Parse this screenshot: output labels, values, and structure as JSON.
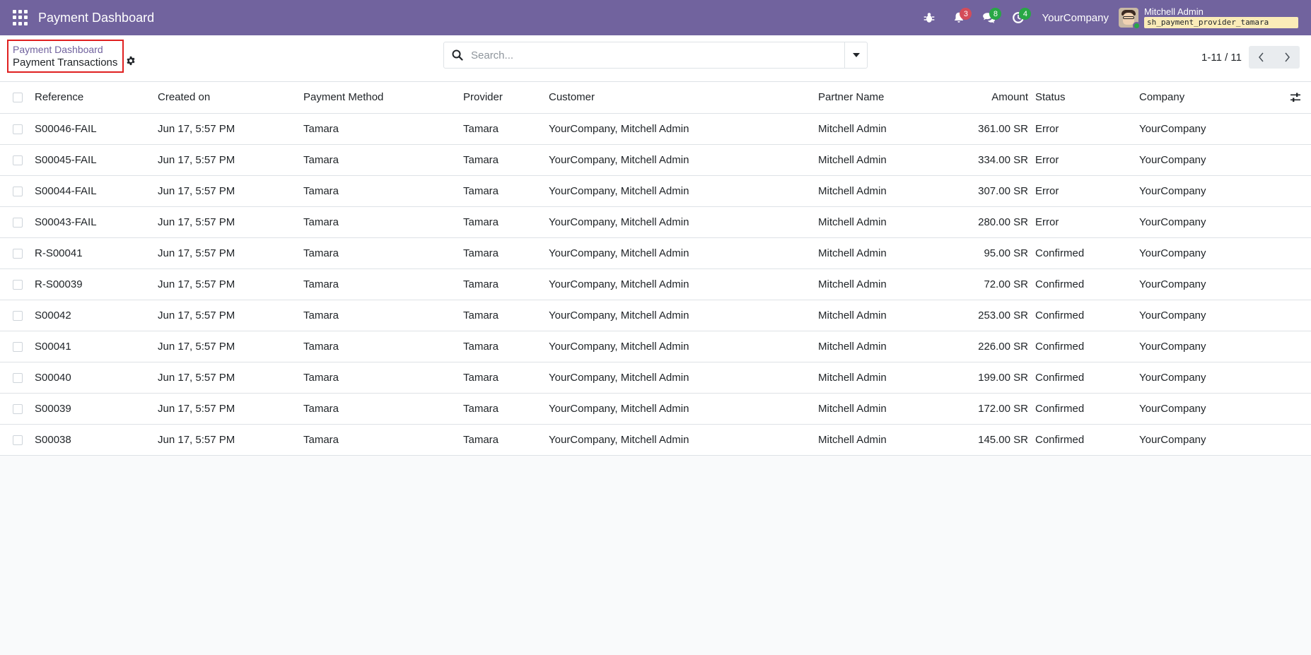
{
  "navbar": {
    "title": "Payment Dashboard",
    "activity_count": "3",
    "messages_count": "8",
    "activities_done_count": "4",
    "company": "YourCompany",
    "user_name": "Mitchell Admin",
    "database": "sh_payment_provider_tamara"
  },
  "breadcrumb": {
    "parent": "Payment Dashboard",
    "current": "Payment Transactions"
  },
  "search": {
    "placeholder": "Search..."
  },
  "pager": {
    "value": "1-11 / 11"
  },
  "table": {
    "headers": {
      "reference": "Reference",
      "created_on": "Created on",
      "payment_method": "Payment Method",
      "provider": "Provider",
      "customer": "Customer",
      "partner_name": "Partner Name",
      "amount": "Amount",
      "status": "Status",
      "company": "Company"
    },
    "rows": [
      {
        "reference": "S00046-FAIL",
        "created_on": "Jun 17, 5:57 PM",
        "payment_method": "Tamara",
        "provider": "Tamara",
        "customer": "YourCompany, Mitchell Admin",
        "partner_name": "Mitchell Admin",
        "amount": "361.00 SR",
        "status": "Error",
        "company": "YourCompany"
      },
      {
        "reference": "S00045-FAIL",
        "created_on": "Jun 17, 5:57 PM",
        "payment_method": "Tamara",
        "provider": "Tamara",
        "customer": "YourCompany, Mitchell Admin",
        "partner_name": "Mitchell Admin",
        "amount": "334.00 SR",
        "status": "Error",
        "company": "YourCompany"
      },
      {
        "reference": "S00044-FAIL",
        "created_on": "Jun 17, 5:57 PM",
        "payment_method": "Tamara",
        "provider": "Tamara",
        "customer": "YourCompany, Mitchell Admin",
        "partner_name": "Mitchell Admin",
        "amount": "307.00 SR",
        "status": "Error",
        "company": "YourCompany"
      },
      {
        "reference": "S00043-FAIL",
        "created_on": "Jun 17, 5:57 PM",
        "payment_method": "Tamara",
        "provider": "Tamara",
        "customer": "YourCompany, Mitchell Admin",
        "partner_name": "Mitchell Admin",
        "amount": "280.00 SR",
        "status": "Error",
        "company": "YourCompany"
      },
      {
        "reference": "R-S00041",
        "created_on": "Jun 17, 5:57 PM",
        "payment_method": "Tamara",
        "provider": "Tamara",
        "customer": "YourCompany, Mitchell Admin",
        "partner_name": "Mitchell Admin",
        "amount": "95.00 SR",
        "status": "Confirmed",
        "company": "YourCompany"
      },
      {
        "reference": "R-S00039",
        "created_on": "Jun 17, 5:57 PM",
        "payment_method": "Tamara",
        "provider": "Tamara",
        "customer": "YourCompany, Mitchell Admin",
        "partner_name": "Mitchell Admin",
        "amount": "72.00 SR",
        "status": "Confirmed",
        "company": "YourCompany"
      },
      {
        "reference": "S00042",
        "created_on": "Jun 17, 5:57 PM",
        "payment_method": "Tamara",
        "provider": "Tamara",
        "customer": "YourCompany, Mitchell Admin",
        "partner_name": "Mitchell Admin",
        "amount": "253.00 SR",
        "status": "Confirmed",
        "company": "YourCompany"
      },
      {
        "reference": "S00041",
        "created_on": "Jun 17, 5:57 PM",
        "payment_method": "Tamara",
        "provider": "Tamara",
        "customer": "YourCompany, Mitchell Admin",
        "partner_name": "Mitchell Admin",
        "amount": "226.00 SR",
        "status": "Confirmed",
        "company": "YourCompany"
      },
      {
        "reference": "S00040",
        "created_on": "Jun 17, 5:57 PM",
        "payment_method": "Tamara",
        "provider": "Tamara",
        "customer": "YourCompany, Mitchell Admin",
        "partner_name": "Mitchell Admin",
        "amount": "199.00 SR",
        "status": "Confirmed",
        "company": "YourCompany"
      },
      {
        "reference": "S00039",
        "created_on": "Jun 17, 5:57 PM",
        "payment_method": "Tamara",
        "provider": "Tamara",
        "customer": "YourCompany, Mitchell Admin",
        "partner_name": "Mitchell Admin",
        "amount": "172.00 SR",
        "status": "Confirmed",
        "company": "YourCompany"
      },
      {
        "reference": "S00038",
        "created_on": "Jun 17, 5:57 PM",
        "payment_method": "Tamara",
        "provider": "Tamara",
        "customer": "YourCompany, Mitchell Admin",
        "partner_name": "Mitchell Admin",
        "amount": "145.00 SR",
        "status": "Confirmed",
        "company": "YourCompany"
      }
    ]
  },
  "colors": {
    "navbar": "#71639e",
    "breadcrumb_link": "#71639e",
    "highlight_box": "#e02020",
    "badge_red": "#d44c59",
    "badge_green": "#28a745"
  }
}
